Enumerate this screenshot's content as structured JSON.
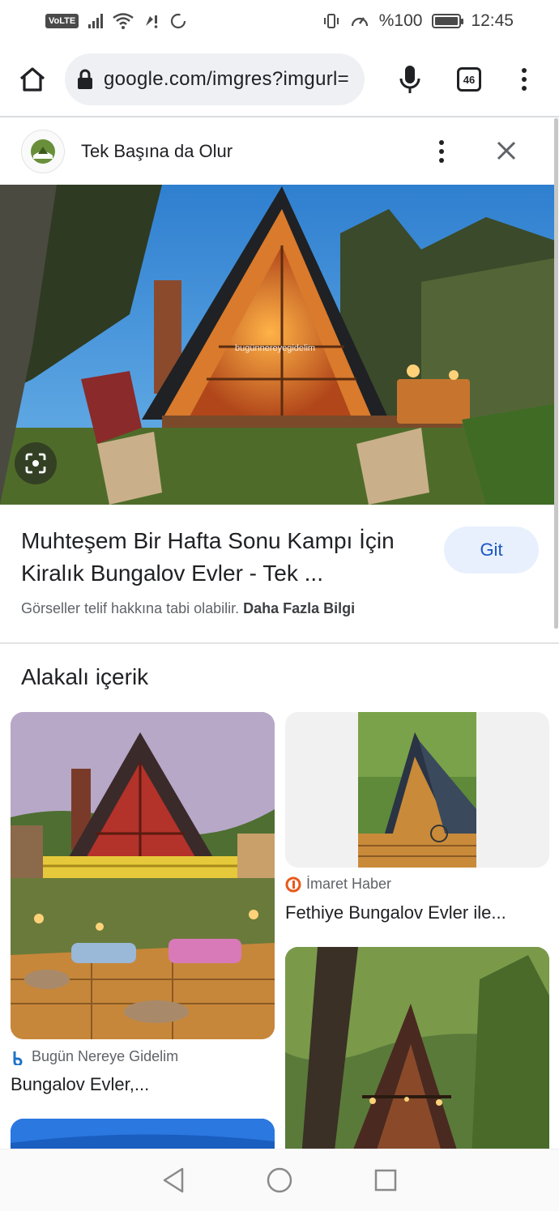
{
  "status_bar": {
    "volte": "VoLTE",
    "battery_text": "%100",
    "time": "12:45",
    "battery_level": 1.0
  },
  "toolbar": {
    "url": "google.com/imgres?imgurl=",
    "tab_count": "46"
  },
  "source": {
    "site_name": "Tek Başına da Olur"
  },
  "hero": {
    "watermark": "bugünnereyegidelim"
  },
  "result": {
    "title": "Muhteşem Bir Hafta Sonu Kampı İçin Kiralık Bungalov Evler - Tek ...",
    "go_label": "Git",
    "copyright_text": "Görseller telif hakkına tabi olabilir. ",
    "more_info": "Daha Fazla Bilgi"
  },
  "related": {
    "heading": "Alakalı içerik",
    "cards": [
      {
        "source": "Bugün Nereye Gidelim",
        "title": "Bungalov Evler,..."
      },
      {
        "source": "İmaret Haber",
        "title": "Fethiye Bungalov Evler ile..."
      }
    ]
  },
  "colors": {
    "accent": "#1a56c4",
    "button_bg": "#e8f0fe",
    "imaret_orange": "#e8591a",
    "bugun_blue": "#1e73c8"
  }
}
